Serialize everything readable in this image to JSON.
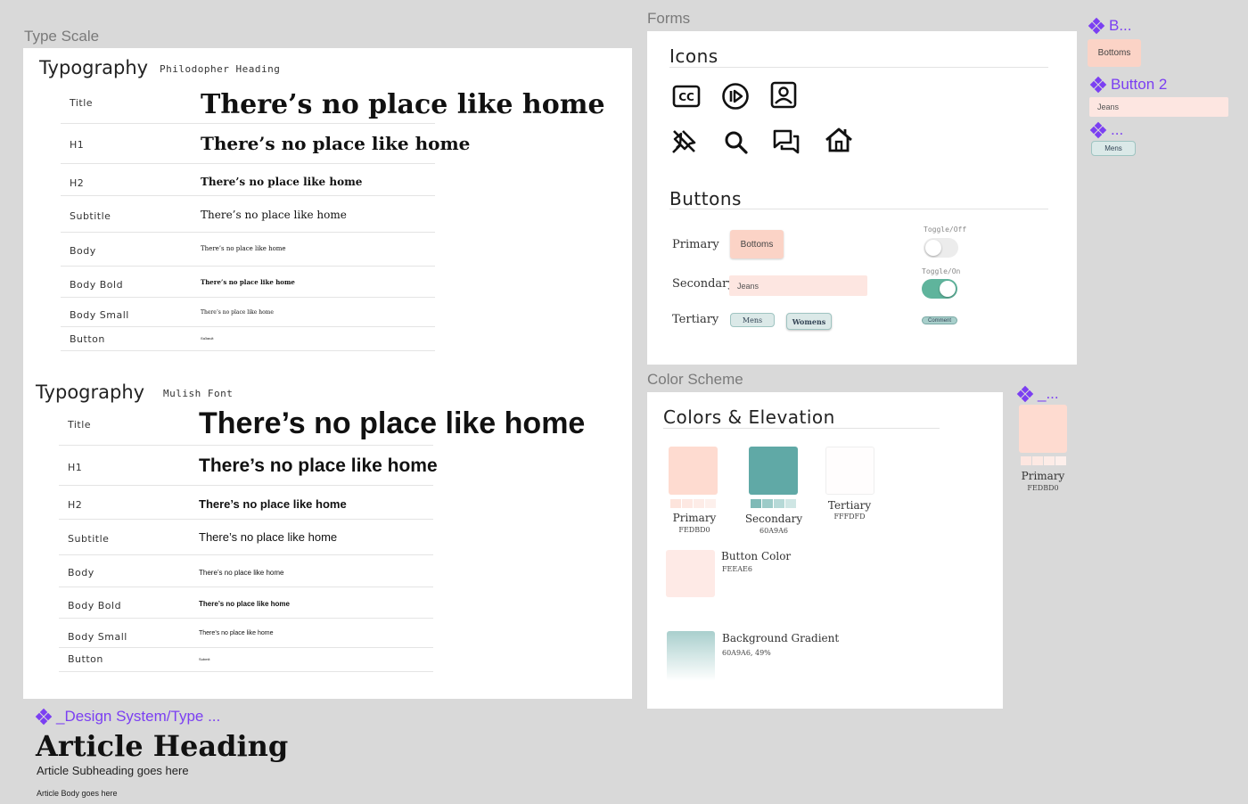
{
  "frames": {
    "type_scale": "Type Scale",
    "forms": "Forms",
    "color_scheme": "Color Scheme"
  },
  "typography_philodopher": {
    "heading": "Typography",
    "font": "Philodopher Heading",
    "rows": [
      {
        "label": "Title",
        "sample": "There’s no place like home"
      },
      {
        "label": "H1",
        "sample": "There’s no place like home"
      },
      {
        "label": "H2",
        "sample": "There’s no place like home"
      },
      {
        "label": "Subtitle",
        "sample": "There’s no place like home"
      },
      {
        "label": "Body",
        "sample": "There’s no place like home"
      },
      {
        "label": "Body Bold",
        "sample": "There’s no place like home"
      },
      {
        "label": "Body Small",
        "sample": "There’s no place like home"
      },
      {
        "label": "Button",
        "sample": "Submit"
      }
    ]
  },
  "typography_mulish": {
    "heading": "Typography",
    "font": "Mulish Font",
    "rows": [
      {
        "label": "Title",
        "sample": "There’s no place like home"
      },
      {
        "label": "H1",
        "sample": "There’s no place like home"
      },
      {
        "label": "H2",
        "sample": "There’s no place like home"
      },
      {
        "label": "Subtitle",
        "sample": "There’s no place like home"
      },
      {
        "label": "Body",
        "sample": "There’s no place like home"
      },
      {
        "label": "Body Bold",
        "sample": "There’s no place like home"
      },
      {
        "label": "Body Small",
        "sample": "There’s no place like home"
      },
      {
        "label": "Button",
        "sample": "Submit"
      }
    ]
  },
  "article": {
    "component_label": "_Design System/Type ...",
    "heading": "Article Heading",
    "subheading": "Article Subheading goes here",
    "body": "Article Body goes here"
  },
  "icons": {
    "title": "Icons",
    "items": [
      "closed-captions-icon",
      "play-circle-icon",
      "user-portrait-icon",
      "no-pin-icon",
      "search-icon",
      "chat-bubbles-icon",
      "home-icon"
    ]
  },
  "buttons": {
    "title": "Buttons",
    "primary_label": "Primary",
    "primary_button": "Bottoms",
    "secondary_label": "Secondary",
    "secondary_button": "Jeans",
    "tertiary_label": "Tertiary",
    "tertiary_button_1": "Mens",
    "tertiary_button_2": "Womens",
    "toggle_off_label": "Toggle/Off",
    "toggle_on_label": "Toggle/On",
    "comment_chip": "Comment"
  },
  "components_right": {
    "c1_label": "B...",
    "c1_button": "Bottoms",
    "c2_label": "Button 2",
    "c2_button": "Jeans",
    "c3_label": "...",
    "c3_button": "Mens",
    "c4_label": "_...",
    "c4_name": "Primary",
    "c4_hex": "FEDBD0"
  },
  "colors": {
    "title": "Colors & Elevation",
    "primary": {
      "name": "Primary",
      "hex": "FEDBD0",
      "color": "#FEDBD0"
    },
    "secondary": {
      "name": "Secondary",
      "hex": "60A9A6",
      "color": "#60A9A6"
    },
    "tertiary": {
      "name": "Tertiary",
      "hex": "FFFDFD",
      "color": "#FFFDFD"
    },
    "button": {
      "name": "Button Color",
      "hex": "FEEAE6",
      "color": "#FEEAE6"
    },
    "gradient": {
      "name": "Background Gradient",
      "hex": "60A9A6, 49%"
    }
  }
}
